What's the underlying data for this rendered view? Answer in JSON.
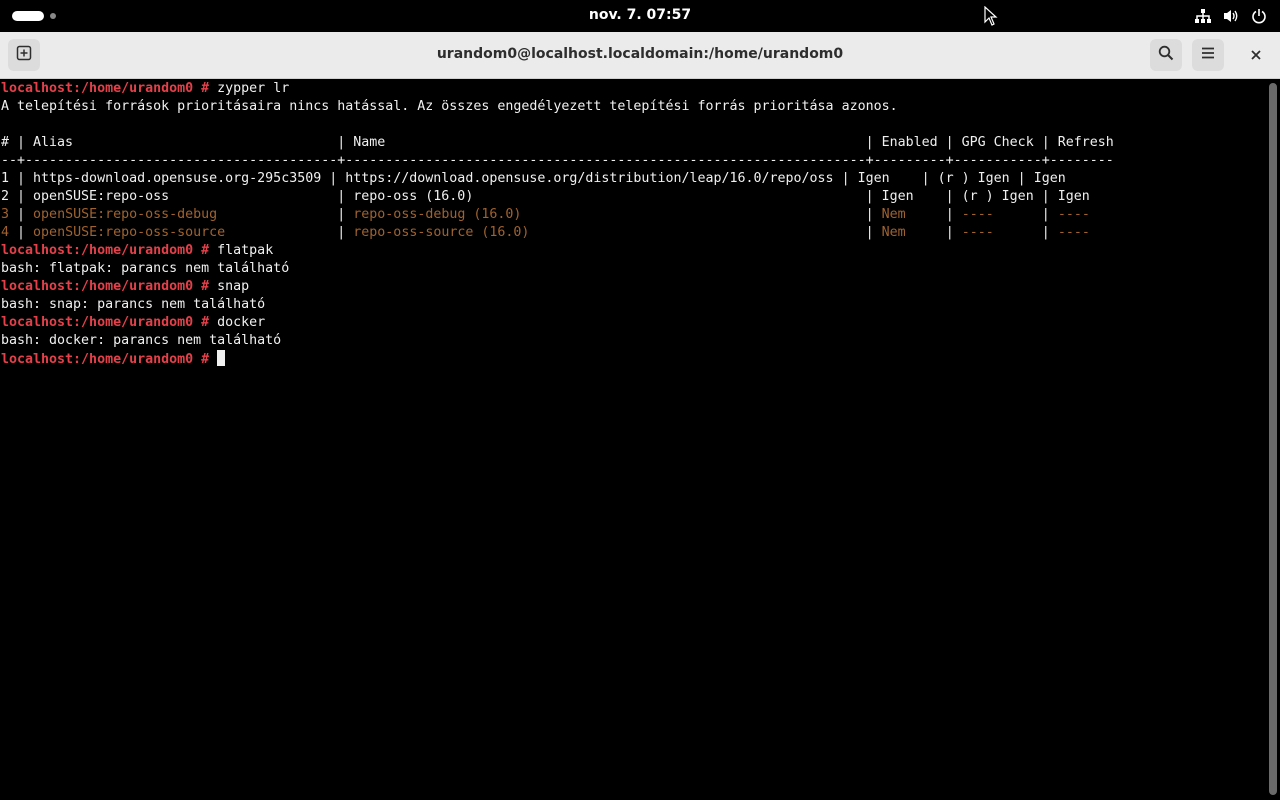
{
  "topbar": {
    "clock": "nov. 7.  07:57",
    "icons": [
      "network-icon",
      "volume-icon",
      "power-icon"
    ]
  },
  "window": {
    "title": "urandom0@localhost.localdomain:/home/urandom0",
    "buttons": [
      "new-tab-icon",
      "search-icon",
      "menu-icon",
      "close-icon"
    ]
  },
  "terminal": {
    "prompt": "localhost:/home/urandom0 # ",
    "lines": [
      {
        "type": "cmd",
        "text": "zypper lr"
      },
      {
        "type": "out",
        "text": "A telepítési források prioritásaira nincs hatással. Az összes engedélyezett telepítési forrás prioritása azonos."
      },
      {
        "type": "out",
        "text": ""
      },
      {
        "type": "out",
        "text": "# | Alias                                 | Name                                                            | Enabled | GPG Check | Refresh"
      },
      {
        "type": "out",
        "text": "--+---------------------------------------+-----------------------------------------------------------------+---------+-----------+--------"
      },
      {
        "type": "out",
        "text": "1 | https-download.opensuse.org-295c3509 | https://download.opensuse.org/distribution/leap/16.0/repo/oss | Igen    | (r ) Igen | Igen"
      },
      {
        "type": "out",
        "text": "2 | openSUSE:repo-oss                     | repo-oss (16.0)                                                 | Igen    | (r ) Igen | Igen"
      },
      {
        "type": "disabled",
        "cells": [
          "3",
          "openSUSE:repo-oss-debug",
          "repo-oss-debug (16.0)",
          "Nem",
          "----",
          "----"
        ]
      },
      {
        "type": "disabled",
        "cells": [
          "4",
          "openSUSE:repo-oss-source",
          "repo-oss-source (16.0)",
          "Nem",
          "----",
          "----"
        ]
      },
      {
        "type": "cmd",
        "text": "flatpak"
      },
      {
        "type": "out",
        "text": "bash: flatpak: parancs nem található"
      },
      {
        "type": "cmd",
        "text": "snap"
      },
      {
        "type": "out",
        "text": "bash: snap: parancs nem található"
      },
      {
        "type": "cmd",
        "text": "docker"
      },
      {
        "type": "out",
        "text": "bash: docker: parancs nem található"
      },
      {
        "type": "cmd",
        "text": ""
      }
    ]
  },
  "colors": {
    "prompt": "#e5404a",
    "disabled_row": "#a0622f",
    "header_bg": "#ebebeb",
    "terminal_bg": "#000000"
  }
}
